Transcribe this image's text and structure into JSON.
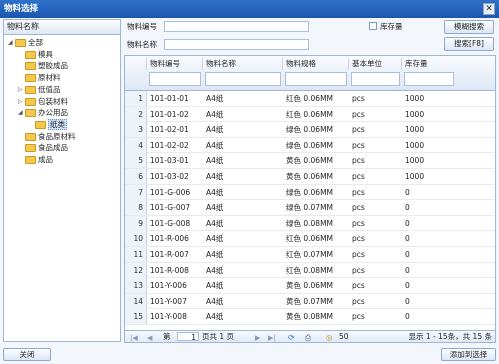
{
  "window": {
    "title": "物料选择",
    "close_glyph": "✕"
  },
  "tree": {
    "header": "物料名称",
    "nodes": [
      {
        "label": "全部",
        "expander": "◢",
        "level": 0
      },
      {
        "label": "模具",
        "expander": "",
        "level": 1
      },
      {
        "label": "塑胶成品",
        "expander": "",
        "level": 1
      },
      {
        "label": "原材料",
        "expander": "",
        "level": 1
      },
      {
        "label": "低值品",
        "expander": "▷",
        "level": 1
      },
      {
        "label": "包装材料",
        "expander": "▷",
        "level": 1
      },
      {
        "label": "办公用品",
        "expander": "◢",
        "level": 1
      },
      {
        "label": "纸类",
        "expander": "",
        "level": 2,
        "selected": true
      },
      {
        "label": "食品原材料",
        "expander": "",
        "level": 1
      },
      {
        "label": "食品成品",
        "expander": "",
        "level": 1
      },
      {
        "label": "成品",
        "expander": "",
        "level": 1
      }
    ]
  },
  "search": {
    "code_label": "物料编号",
    "name_label": "物料名称",
    "stock_label": "库存量",
    "fuzzy_button": "模糊搜索",
    "search_button": "搜索[F8]"
  },
  "grid": {
    "headers": [
      "物料编号",
      "物料名称",
      "物料规格",
      "基本单位",
      "库存量"
    ],
    "rows": [
      [
        "1",
        "101-01-01",
        "A4纸",
        "红色 0.06MM",
        "pcs",
        "1000"
      ],
      [
        "2",
        "101-01-02",
        "A4纸",
        "红色 0.06MM",
        "pcs",
        "1000"
      ],
      [
        "3",
        "101-02-01",
        "A4纸",
        "绿色 0.06MM",
        "pcs",
        "1000"
      ],
      [
        "4",
        "101-02-02",
        "A4纸",
        "绿色 0.06MM",
        "pcs",
        "1000"
      ],
      [
        "5",
        "101-03-01",
        "A4纸",
        "黄色 0.06MM",
        "pcs",
        "1000"
      ],
      [
        "6",
        "101-03-02",
        "A4纸",
        "黄色 0.06MM",
        "pcs",
        "1000"
      ],
      [
        "7",
        "101-G-006",
        "A4纸",
        "绿色 0.06MM",
        "pcs",
        "0"
      ],
      [
        "8",
        "101-G-007",
        "A4纸",
        "绿色 0.07MM",
        "pcs",
        "0"
      ],
      [
        "9",
        "101-G-008",
        "A4纸",
        "绿色 0.08MM",
        "pcs",
        "0"
      ],
      [
        "10",
        "101-R-006",
        "A4纸",
        "红色 0.06MM",
        "pcs",
        "0"
      ],
      [
        "11",
        "101-R-007",
        "A4纸",
        "红色 0.07MM",
        "pcs",
        "0"
      ],
      [
        "12",
        "101-R-008",
        "A4纸",
        "红色 0.08MM",
        "pcs",
        "0"
      ],
      [
        "13",
        "101-Y-006",
        "A4纸",
        "黄色 0.06MM",
        "pcs",
        "0"
      ],
      [
        "14",
        "101-Y-007",
        "A4纸",
        "黄色 0.07MM",
        "pcs",
        "0"
      ],
      [
        "15",
        "101-Y-008",
        "A4纸",
        "黄色 0.08MM",
        "pcs",
        "0"
      ]
    ]
  },
  "pager": {
    "first": "|◀",
    "prev": "◀",
    "page_prefix": "第",
    "page_value": "1",
    "page_suffix": "页共 1 页",
    "next": "▶",
    "last": "▶|",
    "page_size": "50",
    "summary": "显示 1 - 15条，共 15 条"
  },
  "footer": {
    "close_button": "关闭",
    "confirm_button": "添加到选择"
  }
}
